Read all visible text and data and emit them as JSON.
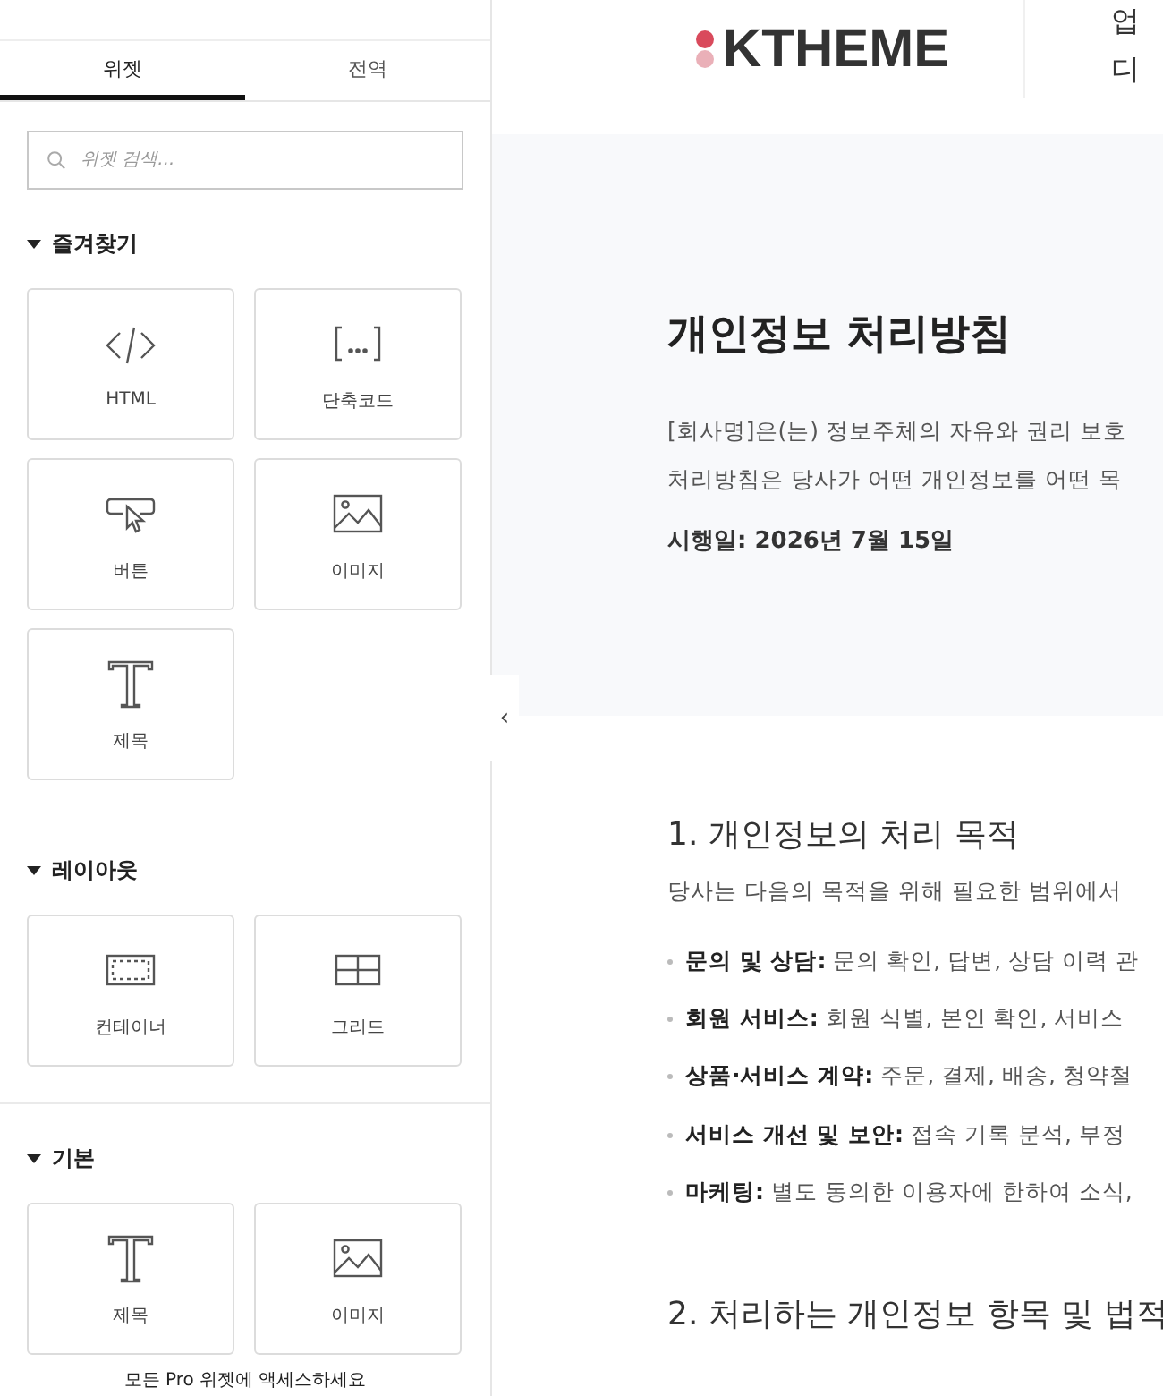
{
  "panel": {
    "tabs": [
      {
        "label": "위젯",
        "selected": true
      },
      {
        "label": "전역",
        "selected": false
      }
    ],
    "search": {
      "placeholder": "위젯 검색..."
    },
    "sections": [
      {
        "title": "즐겨찾기",
        "expanded": true,
        "widgets": [
          {
            "kind": "code",
            "label": "HTML"
          },
          {
            "kind": "shortcode",
            "label": "단축코드"
          },
          {
            "kind": "button",
            "label": "버튼"
          },
          {
            "kind": "image",
            "label": "이미지"
          },
          {
            "kind": "heading",
            "label": "제목"
          }
        ]
      },
      {
        "title": "레이아웃",
        "expanded": true,
        "widgets": [
          {
            "kind": "container",
            "label": "컨테이너"
          },
          {
            "kind": "grid",
            "label": "그리드"
          }
        ]
      },
      {
        "title": "기본",
        "expanded": true,
        "widgets": [
          {
            "kind": "heading",
            "label": "제목"
          },
          {
            "kind": "image",
            "label": "이미지"
          }
        ]
      }
    ],
    "promo": "모든 Pro 위젯에 액세스하세요",
    "collapse": "‹"
  },
  "site": {
    "logo": "KTHEME",
    "header_lines": [
      "업",
      "디"
    ]
  },
  "hero": {
    "title": "개인정보 처리방침",
    "intro_lines": [
      "[회사명]은(는) 정보주체의 자유와 권리 보호",
      "처리방침은 당사가 어떤 개인정보를 어떤 목"
    ],
    "effective": "시행일: 2026년 7월 15일"
  },
  "sections": [
    {
      "heading": "1. 개인정보의 처리 목적",
      "description": "당사는 다음의 목적을 위해 필요한 범위에서",
      "bullets": [
        "**문의 및 상담:** 문의 확인, 답변, 상담 이력 관",
        "**회원 서비스:** 회원 식별, 본인 확인, 서비스",
        "**상품·서비스 계약:** 주문, 결제, 배송, 청약철",
        "**서비스 개선 및 보안:** 접속 기록 분석, 부정",
        "**마케팅:** 별도 동의한 이용자에 한하여 소식,"
      ]
    },
    {
      "heading": "2. 처리하는 개인정보 항목 및 법적"
    }
  ]
}
